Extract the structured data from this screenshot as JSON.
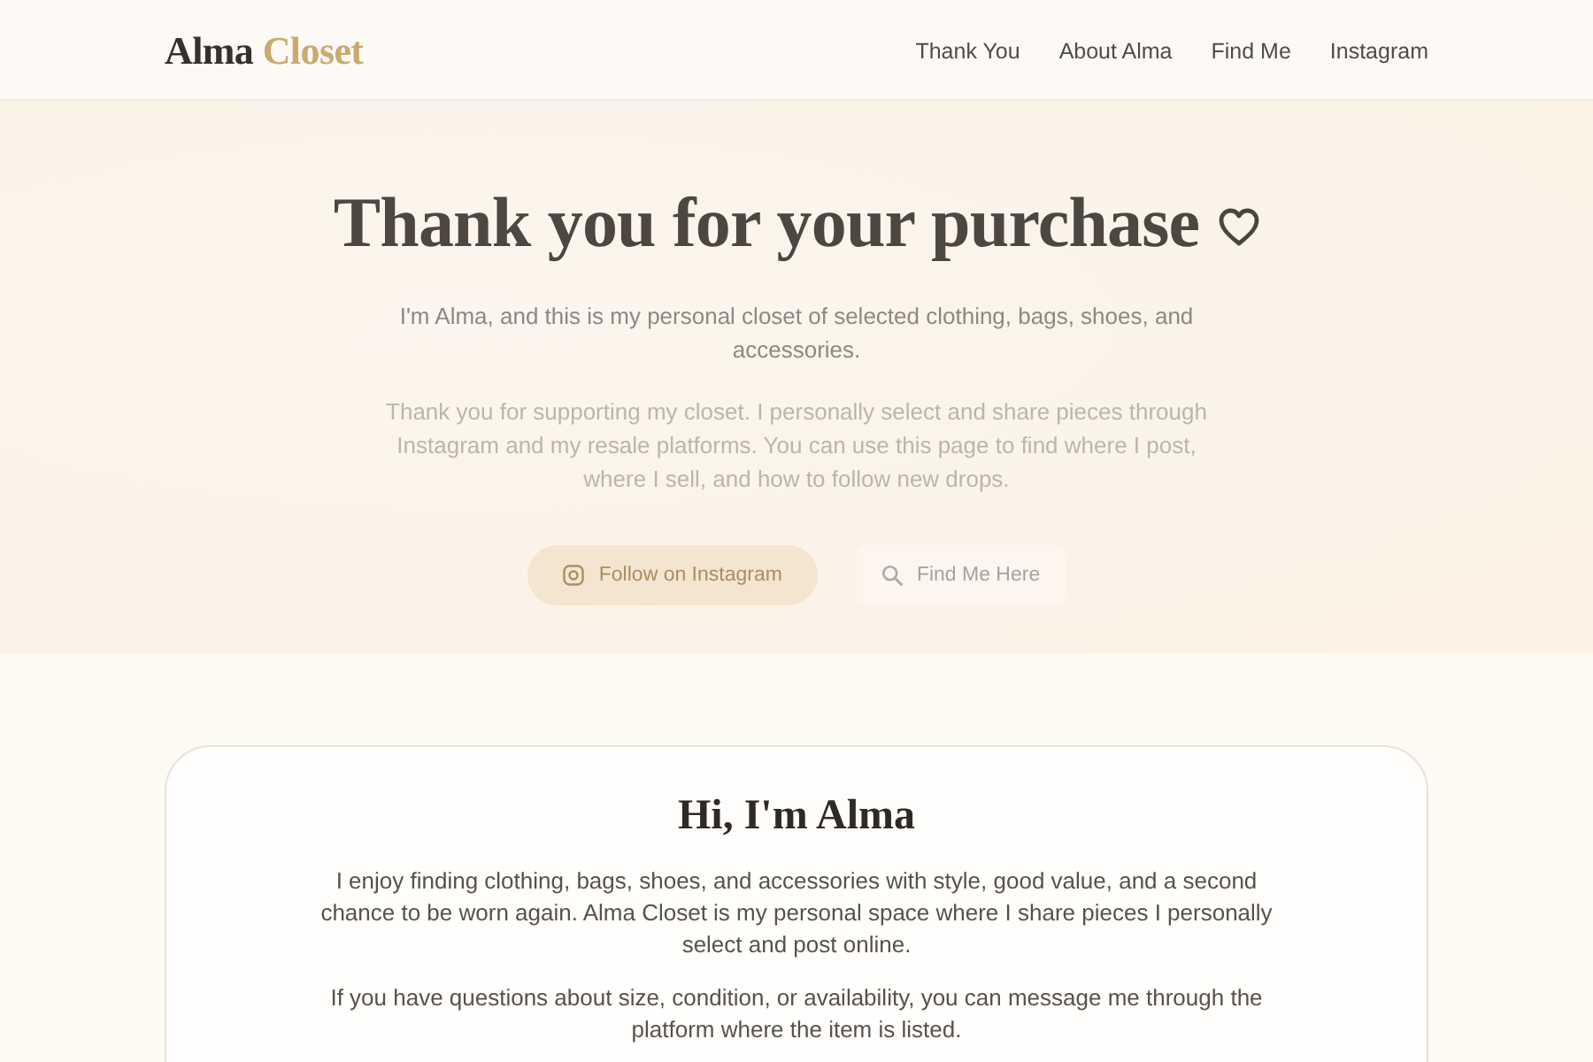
{
  "header": {
    "logo": {
      "name": "Alma",
      "accent": "Closet"
    },
    "nav": [
      "Thank You",
      "About Alma",
      "Find Me",
      "Instagram"
    ]
  },
  "hero": {
    "title": "Thank you for your purchase",
    "intro": "I'm Alma, and this is my personal closet of selected clothing, bags, shoes, and accessories.",
    "note": "Thank you for supporting my closet. I personally select and share pieces through Instagram and my resale platforms. You can use this page to find where I post, where I sell, and how to follow new drops.",
    "buttons": [
      {
        "kind": "primary",
        "label": "Follow on Instagram"
      },
      {
        "kind": "secondary",
        "label": "Find Me Here"
      }
    ]
  },
  "about": {
    "title": "Hi, I'm Alma",
    "paragraphs": [
      "I enjoy finding clothing, bags, shoes, and accessories with style, good value, and a second chance to be worn again. Alma Closet is my personal space where I share pieces I personally select and post online.",
      "If you have questions about size, condition, or availability, you can message me through the platform where the item is listed."
    ]
  }
}
